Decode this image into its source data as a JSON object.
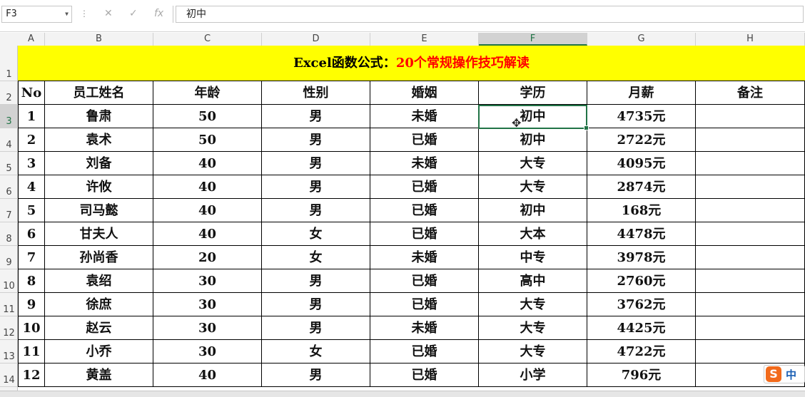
{
  "formula_bar": {
    "name_box": "F3",
    "cancel_icon": "✕",
    "enter_icon": "✓",
    "fx_label": "fx",
    "formula": "初中"
  },
  "columns": [
    "A",
    "B",
    "C",
    "D",
    "E",
    "F",
    "G",
    "H"
  ],
  "selected_column": "F",
  "rows": [
    "1",
    "2",
    "3",
    "4",
    "5",
    "6",
    "7",
    "8",
    "9",
    "10",
    "11",
    "12",
    "13",
    "14"
  ],
  "selected_row": "3",
  "sheet": {
    "title_black": "Excel函数公式：",
    "title_red": "20个常规操作技巧解读",
    "headers": [
      "No",
      "员工姓名",
      "年龄",
      "性别",
      "婚姻",
      "学历",
      "月薪",
      "备注"
    ],
    "records": [
      [
        "1",
        "鲁肃",
        "50",
        "男",
        "未婚",
        "初中",
        "4735元",
        ""
      ],
      [
        "2",
        "袁术",
        "50",
        "男",
        "已婚",
        "初中",
        "2722元",
        ""
      ],
      [
        "3",
        "刘备",
        "40",
        "男",
        "未婚",
        "大专",
        "4095元",
        ""
      ],
      [
        "4",
        "许攸",
        "40",
        "男",
        "已婚",
        "大专",
        "2874元",
        ""
      ],
      [
        "5",
        "司马懿",
        "40",
        "男",
        "已婚",
        "初中",
        "168元",
        ""
      ],
      [
        "6",
        "甘夫人",
        "40",
        "女",
        "已婚",
        "大本",
        "4478元",
        ""
      ],
      [
        "7",
        "孙尚香",
        "20",
        "女",
        "未婚",
        "中专",
        "3978元",
        ""
      ],
      [
        "8",
        "袁绍",
        "30",
        "男",
        "已婚",
        "高中",
        "2760元",
        ""
      ],
      [
        "9",
        "徐庶",
        "30",
        "男",
        "已婚",
        "大专",
        "3762元",
        ""
      ],
      [
        "10",
        "赵云",
        "30",
        "男",
        "未婚",
        "大专",
        "4425元",
        ""
      ],
      [
        "11",
        "小乔",
        "30",
        "女",
        "已婚",
        "大专",
        "4722元",
        ""
      ],
      [
        "12",
        "黄盖",
        "40",
        "男",
        "已婚",
        "小学",
        "796元",
        ""
      ]
    ]
  },
  "ime": {
    "logo": "S",
    "mode": "中"
  },
  "colors": {
    "title_bg": "#ffff00",
    "title_red": "#ff0000",
    "accent": "#217346"
  }
}
